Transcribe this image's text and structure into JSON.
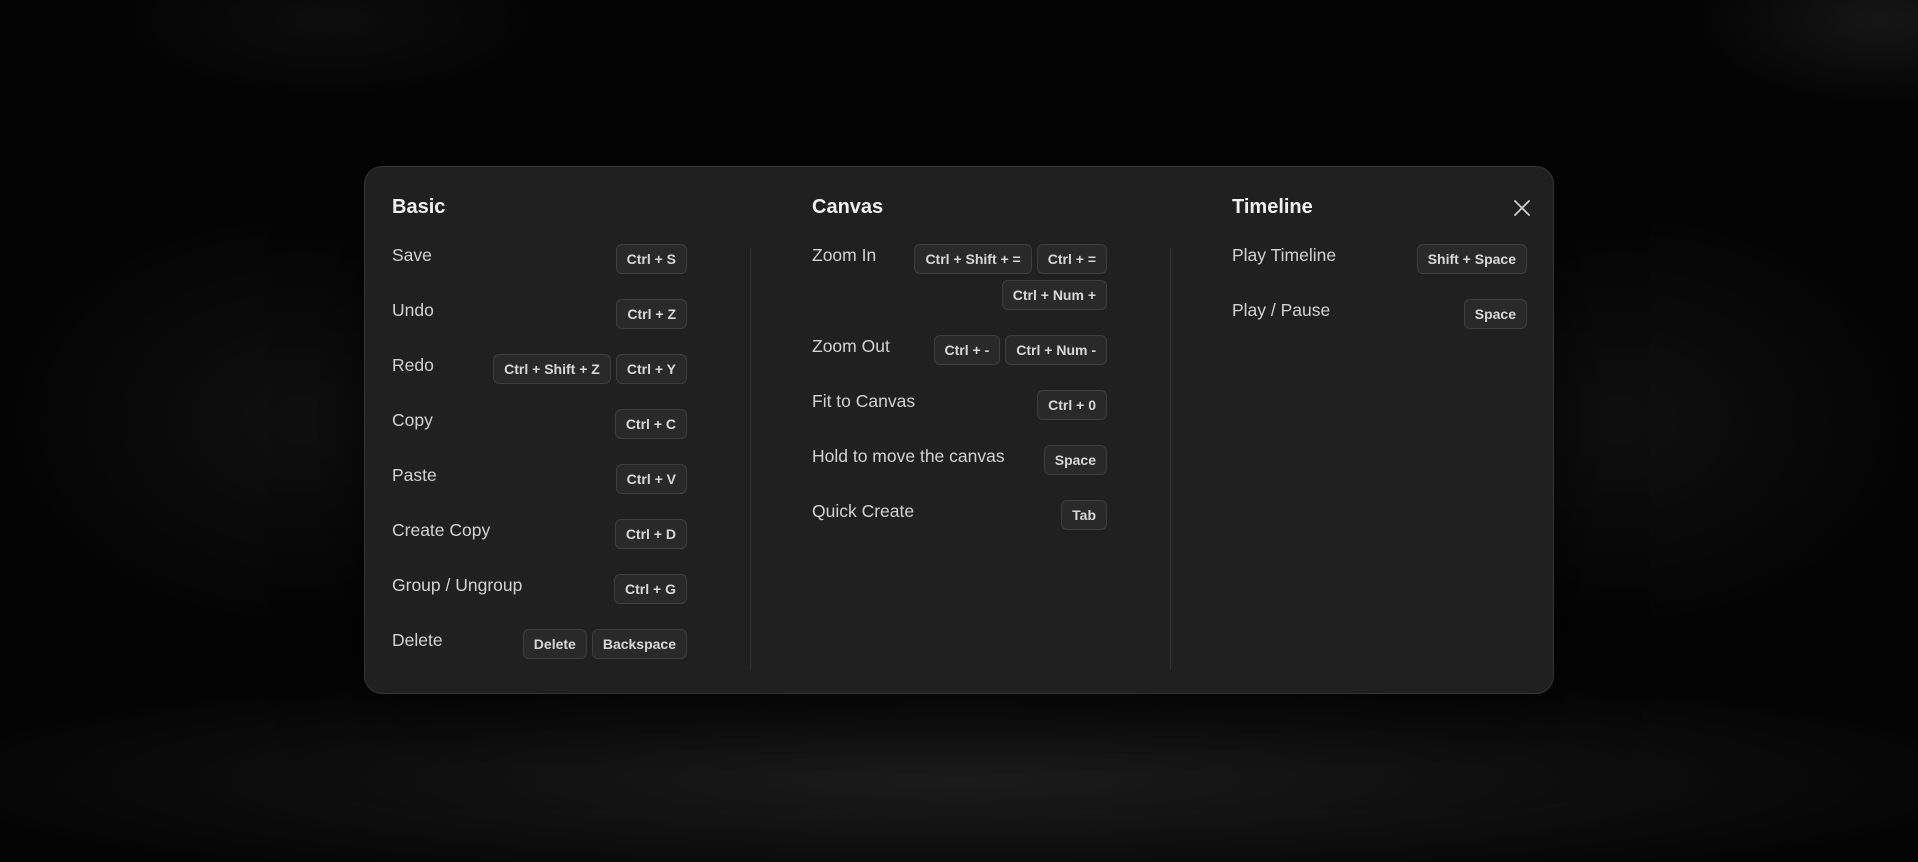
{
  "dialog": {
    "close_icon": "close-icon",
    "columns": [
      {
        "title": "Basic",
        "rows": [
          {
            "label": "Save",
            "keys": [
              "Ctrl + S"
            ]
          },
          {
            "label": "Undo",
            "keys": [
              "Ctrl + Z"
            ]
          },
          {
            "label": "Redo",
            "keys": [
              "Ctrl + Shift + Z",
              "Ctrl + Y"
            ]
          },
          {
            "label": "Copy",
            "keys": [
              "Ctrl + C"
            ]
          },
          {
            "label": "Paste",
            "keys": [
              "Ctrl + V"
            ]
          },
          {
            "label": "Create Copy",
            "keys": [
              "Ctrl + D"
            ]
          },
          {
            "label": "Group / Ungroup",
            "keys": [
              "Ctrl + G"
            ]
          },
          {
            "label": "Delete",
            "keys": [
              "Delete",
              "Backspace"
            ]
          }
        ]
      },
      {
        "title": "Canvas",
        "rows": [
          {
            "label": "Zoom In",
            "keys": [
              "Ctrl + Shift + =",
              "Ctrl + =",
              "Ctrl + Num +"
            ]
          },
          {
            "label": "Zoom Out",
            "keys": [
              "Ctrl + -",
              "Ctrl + Num -"
            ]
          },
          {
            "label": "Fit to Canvas",
            "keys": [
              "Ctrl + 0"
            ]
          },
          {
            "label": "Hold to move the canvas",
            "keys": [
              "Space"
            ]
          },
          {
            "label": "Quick Create",
            "keys": [
              "Tab"
            ]
          }
        ]
      },
      {
        "title": "Timeline",
        "rows": [
          {
            "label": "Play Timeline",
            "keys": [
              "Shift + Space"
            ]
          },
          {
            "label": "Play / Pause",
            "keys": [
              "Space"
            ]
          }
        ]
      }
    ]
  }
}
